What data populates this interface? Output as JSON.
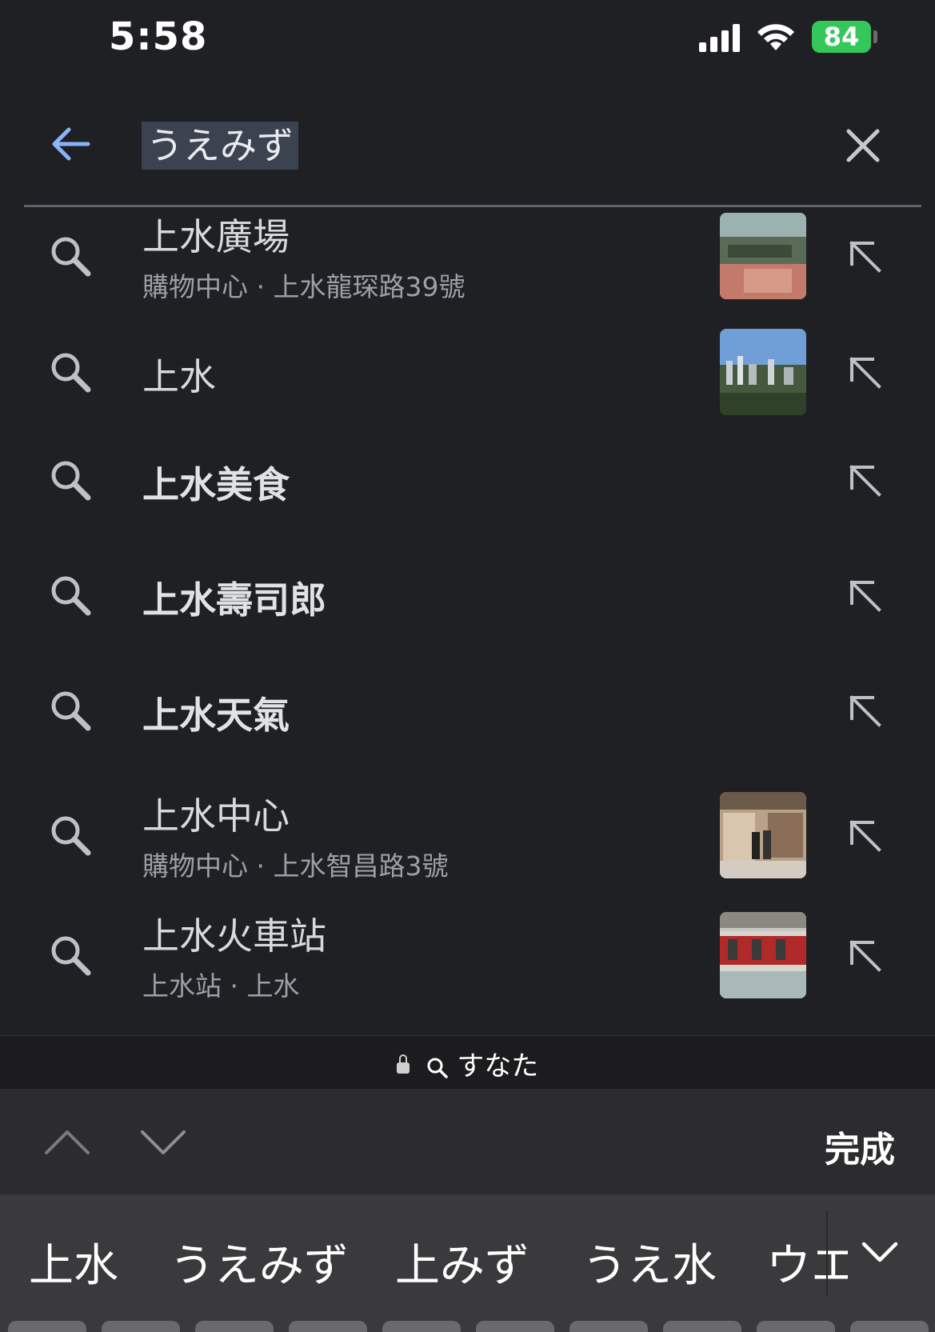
{
  "status_bar": {
    "time": "5:58",
    "battery": "84"
  },
  "search": {
    "query": "うえみず"
  },
  "suggestions": [
    {
      "title": "上水廣場",
      "subtitle": "購物中心 · 上水龍琛路39號",
      "has_thumbnail": true,
      "thumb": "mall"
    },
    {
      "title": "上水",
      "subtitle": "",
      "has_thumbnail": true,
      "thumb": "city"
    },
    {
      "title": "上水美食",
      "subtitle": "",
      "has_thumbnail": false
    },
    {
      "title": "上水壽司郎",
      "subtitle": "",
      "has_thumbnail": false
    },
    {
      "title": "上水天氣",
      "subtitle": "",
      "has_thumbnail": false
    },
    {
      "title": "上水中心",
      "subtitle": "購物中心 · 上水智昌路3號",
      "has_thumbnail": true,
      "thumb": "shop"
    },
    {
      "title": "上水火車站",
      "subtitle": "上水站 · 上水",
      "has_thumbnail": true,
      "thumb": "train"
    }
  ],
  "url_bar": {
    "text": "すなた"
  },
  "keyboard": {
    "done_label": "完成",
    "candidates": [
      "上水",
      "うえみず",
      "上みず",
      "うえ水",
      "ウエ"
    ]
  },
  "colors": {
    "accent": "#8ab4f8",
    "background": "#1f2024",
    "battery": "#34c759"
  }
}
